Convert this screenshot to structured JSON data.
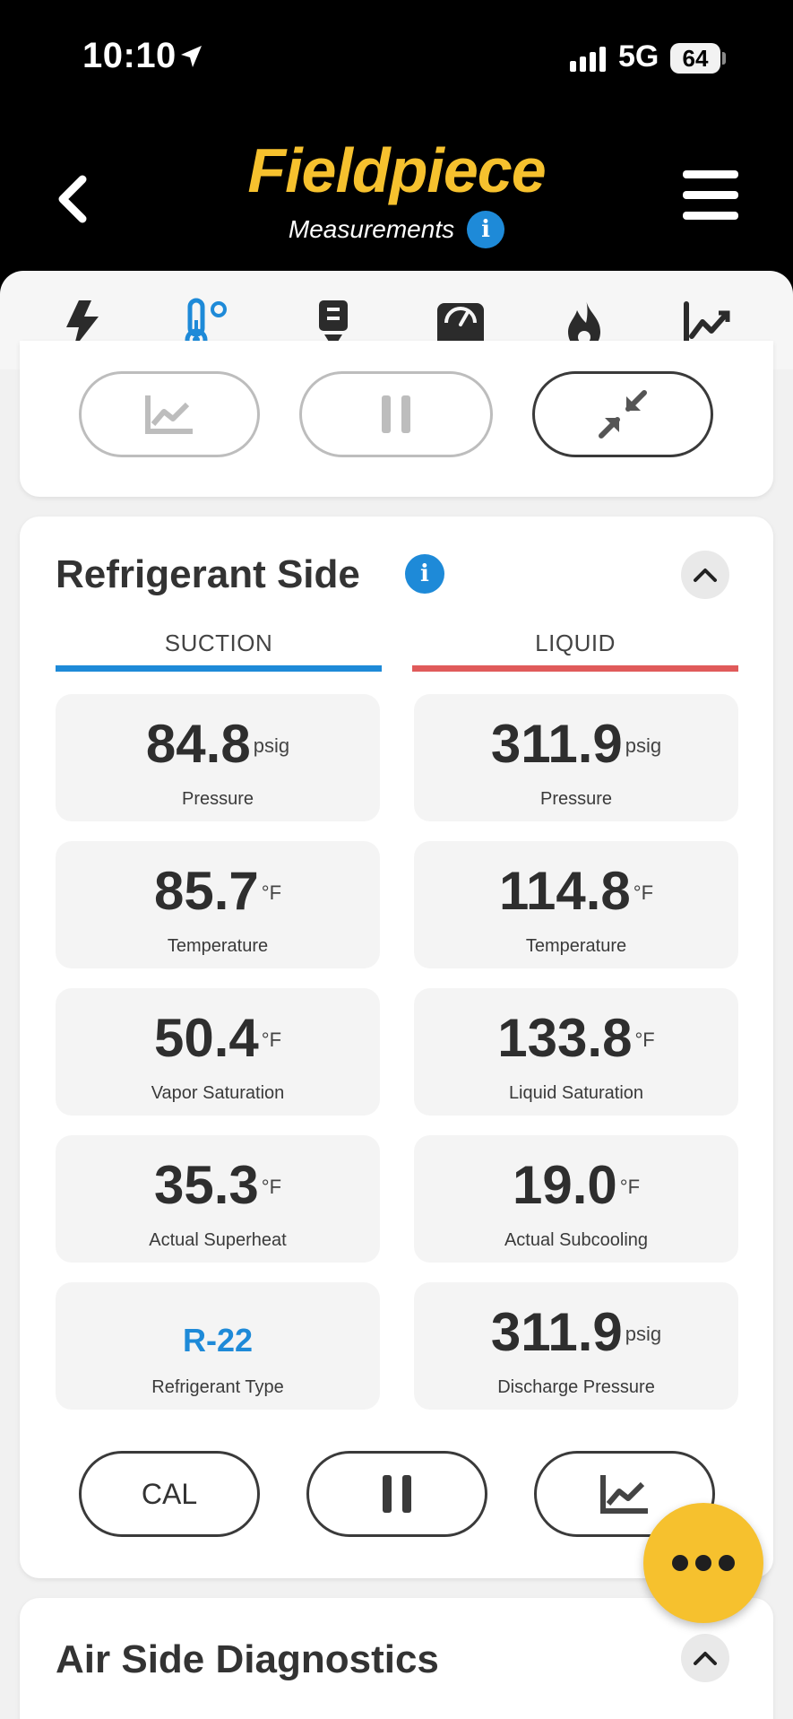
{
  "status_bar": {
    "time": "10:10",
    "network": "5G",
    "battery": "64"
  },
  "header": {
    "brand": "Fieldpiece",
    "subtitle": "Measurements",
    "info_glyph": "i",
    "brand_color": "#f6c12e"
  },
  "tabs": [
    {
      "icon": "lightning-icon"
    },
    {
      "icon": "thermometer-icon",
      "active": true
    },
    {
      "icon": "probe-icon"
    },
    {
      "icon": "gauge-icon"
    },
    {
      "icon": "flame-icon"
    },
    {
      "icon": "trend-chart-icon"
    }
  ],
  "refrigerant": {
    "title": "Refrigerant Side",
    "info_glyph": "i",
    "suction_label": "SUCTION",
    "liquid_label": "LIQUID",
    "suction_color": "#1e8ad8",
    "liquid_color": "#e05a5a",
    "suction": [
      {
        "value": "84.8",
        "unit": "psig",
        "label": "Pressure"
      },
      {
        "value": "85.7",
        "unit": "°F",
        "label": "Temperature"
      },
      {
        "value": "50.4",
        "unit": "°F",
        "label": "Vapor Saturation"
      },
      {
        "value": "35.3",
        "unit": "°F",
        "label": "Actual Superheat"
      },
      {
        "type": "R-22",
        "label": "Refrigerant Type"
      }
    ],
    "liquid": [
      {
        "value": "311.9",
        "unit": "psig",
        "label": "Pressure"
      },
      {
        "value": "114.8",
        "unit": "°F",
        "label": "Temperature"
      },
      {
        "value": "133.8",
        "unit": "°F",
        "label": "Liquid Saturation"
      },
      {
        "value": "19.0",
        "unit": "°F",
        "label": "Actual Subcooling"
      },
      {
        "value": "311.9",
        "unit": "psig",
        "label": "Discharge Pressure"
      }
    ],
    "cal_label": "CAL"
  },
  "air_side": {
    "title": "Air Side Diagnostics"
  }
}
